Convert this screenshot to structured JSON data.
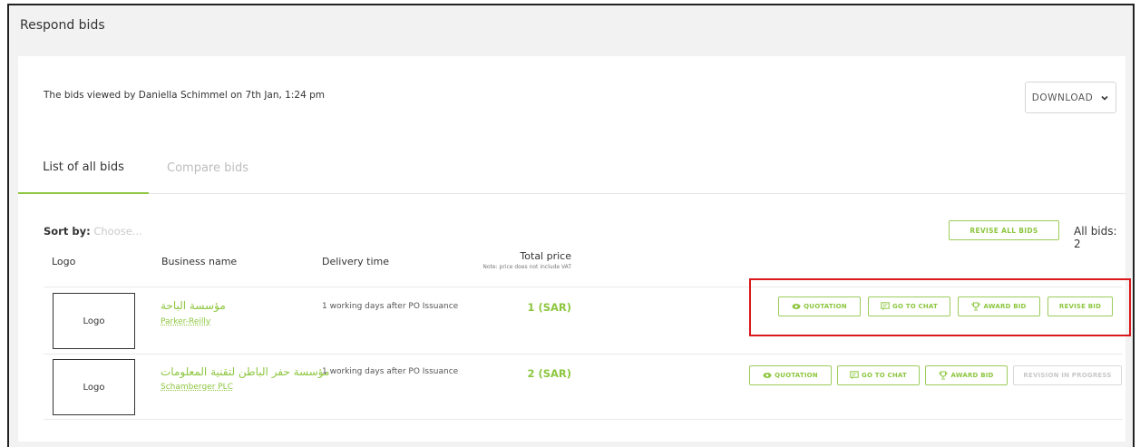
{
  "page": {
    "title": "Respond bids"
  },
  "header": {
    "viewed_text": "The bids viewed by Daniella Schimmel on 7th Jan, 1:24 pm",
    "download_label": "DOWNLOAD"
  },
  "tabs": [
    {
      "label": "List of all bids",
      "active": true
    },
    {
      "label": "Compare bids",
      "active": false
    }
  ],
  "toolbar": {
    "sort_label": "Sort by:",
    "sort_placeholder": "Choose...",
    "revise_all_label": "REVISE ALL BIDS",
    "all_bids_label": "All bids: 2"
  },
  "columns": {
    "logo": "Logo",
    "business": "Business name",
    "delivery": "Delivery time",
    "total": "Total price",
    "total_note": "Note: price does not include VAT"
  },
  "bids": [
    {
      "logo": "Logo",
      "name_ar": "مؤسسة الباحة",
      "name_en": "Parker-Reilly",
      "delivery": "1 working days after PO Issuance",
      "price": "1 (SAR)",
      "actions": {
        "quotation": "QUOTATION",
        "chat": "GO TO CHAT",
        "award": "AWARD BID",
        "revise": "REVISE BID"
      }
    },
    {
      "logo": "Logo",
      "name_ar": "مؤسسة حفر الباطن لتقنية المعلومات",
      "name_en": "Schamberger PLC",
      "delivery": "1 working days after PO Issuance",
      "price": "2 (SAR)",
      "actions": {
        "quotation": "QUOTATION",
        "chat": "GO TO CHAT",
        "award": "AWARD BID",
        "revise": "REVISION IN PROGRESS"
      }
    }
  ],
  "colors": {
    "accent": "#8dc63f",
    "highlight": "#d9191c",
    "disabled": "#c8c8c8"
  },
  "icons": [
    "chevron-down-icon",
    "eye-icon",
    "chat-icon",
    "trophy-icon"
  ]
}
